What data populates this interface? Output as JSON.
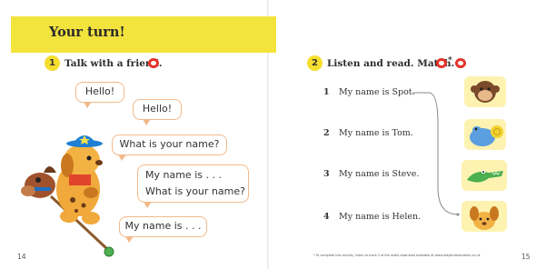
{
  "left_page": {
    "banner_title": "Your turn!",
    "section_number": "1",
    "instruction": "Talk with a friend.",
    "bubbles": {
      "b1": "Hello!",
      "b2": "Hello!",
      "b3": "What is your name?",
      "b4_line1": "My name is . . .",
      "b4_line2": "What is your name?",
      "b5": "My name is . . ."
    },
    "page_number": "14"
  },
  "right_page": {
    "section_number": "2",
    "instruction": "Listen and read. Match.",
    "icon_asterisk": "*",
    "rows": [
      {
        "num": "1",
        "text": "My name is Spot."
      },
      {
        "num": "2",
        "text": "My name is Tom."
      },
      {
        "num": "3",
        "text": "My name is Steve."
      },
      {
        "num": "4",
        "text": "My name is Helen."
      }
    ],
    "pictures": [
      "monkey-picture",
      "hippo-picture",
      "crocodile-picture",
      "spot-dog-picture"
    ],
    "footnote": "* To complete this activity, listen to track 2 of the audio download available at www.ladybirdeducation.co.uk",
    "page_number": "15"
  },
  "colors": {
    "banner_yellow": "#f3e33d",
    "number_circle": "#f6de2e",
    "bubble_border": "#f2b98a",
    "speech_icon_red": "#e4342b",
    "picture_bg": "#fdf2b0"
  }
}
